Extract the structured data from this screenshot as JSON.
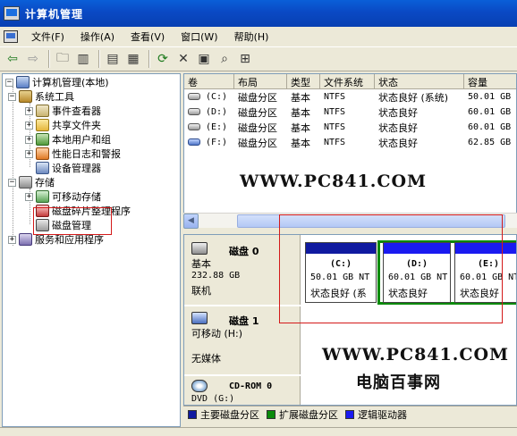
{
  "window": {
    "title": "计算机管理"
  },
  "menu": [
    "文件(F)",
    "操作(A)",
    "查看(V)",
    "窗口(W)",
    "帮助(H)"
  ],
  "toolbar": {
    "icons": [
      "back-icon",
      "forward-icon",
      "up-folder-icon",
      "show-hide-tree-icon",
      "properties-icon",
      "export-icon",
      "refresh-icon",
      "delete-icon",
      "disk-properties-icon",
      "search-icon",
      "help-icon"
    ]
  },
  "tree": {
    "root": "计算机管理(本地)",
    "system_tools": "系统工具",
    "event_viewer": "事件查看器",
    "shared_folders": "共享文件夹",
    "local_users": "本地用户和组",
    "perf_logs": "性能日志和警报",
    "device_manager": "设备管理器",
    "storage": "存储",
    "removable_storage": "可移动存储",
    "defrag": "磁盘碎片整理程序",
    "disk_mgmt": "磁盘管理",
    "services": "服务和应用程序"
  },
  "volume_list": {
    "columns": [
      "卷",
      "布局",
      "类型",
      "文件系统",
      "状态",
      "容量"
    ],
    "rows": [
      {
        "vol": "(C:)",
        "layout": "磁盘分区",
        "type": "基本",
        "fs": "NTFS",
        "status": "状态良好 (系统)",
        "cap": "50.01 GB"
      },
      {
        "vol": "(D:)",
        "layout": "磁盘分区",
        "type": "基本",
        "fs": "NTFS",
        "status": "状态良好",
        "cap": "60.01 GB"
      },
      {
        "vol": "(E:)",
        "layout": "磁盘分区",
        "type": "基本",
        "fs": "NTFS",
        "status": "状态良好",
        "cap": "60.01 GB"
      },
      {
        "vol": "(F:)",
        "layout": "磁盘分区",
        "type": "基本",
        "fs": "NTFS",
        "status": "状态良好",
        "cap": "62.85 GB"
      }
    ]
  },
  "watermark": {
    "url1": "WWW.PC841.COM",
    "url2": "WWW.PC841.COM",
    "cn": "电脑百事网"
  },
  "disks": {
    "disk0": {
      "name": "磁盘 0",
      "type": "基本",
      "size": "232.88 GB",
      "state": "联机"
    },
    "disk1": {
      "name": "磁盘 1",
      "type": "可移动 (H:)",
      "state": "无媒体"
    },
    "cdrom0": {
      "name": "CD-ROM 0",
      "type": "DVD (G:)"
    },
    "partitions": [
      {
        "name": "(C:)",
        "size": "50.01 GB NT",
        "status": "状态良好 (系"
      },
      {
        "name": "(D:)",
        "size": "60.01 GB NT",
        "status": "状态良好"
      },
      {
        "name": "(E:)",
        "size": "60.01 GB NT",
        "status": "状态良好"
      }
    ]
  },
  "legend": [
    {
      "label": "主要磁盘分区",
      "color": "#101aa0"
    },
    {
      "label": "扩展磁盘分区",
      "color": "#0a8a0a"
    },
    {
      "label": "逻辑驱动器",
      "color": "#1a1af0"
    }
  ],
  "colors": {
    "highlight": "#d41a1a",
    "titlebar": "#0a49c4"
  }
}
